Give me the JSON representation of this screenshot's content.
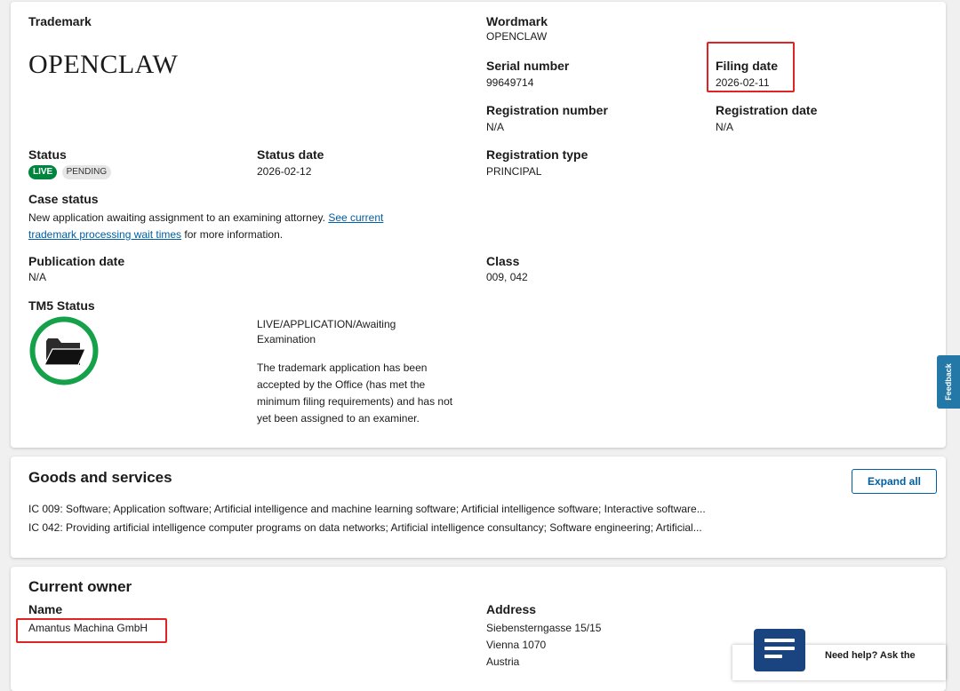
{
  "trademark": {
    "label": "Trademark",
    "wordmark_display": "OPENCLAW",
    "wordmark_label": "Wordmark",
    "wordmark_value": "OPENCLAW",
    "serial_label": "Serial number",
    "serial_value": "99649714",
    "filing_date_label": "Filing date",
    "filing_date_value": "2026-02-11",
    "reg_number_label": "Registration number",
    "reg_number_value": "N/A",
    "reg_date_label": "Registration date",
    "reg_date_value": "N/A",
    "status_label": "Status",
    "status_badges": [
      "LIVE",
      "PENDING"
    ],
    "status_date_label": "Status date",
    "status_date_value": "2026-02-12",
    "reg_type_label": "Registration type",
    "reg_type_value": "PRINCIPAL",
    "case_status_label": "Case status",
    "case_status_text": "New application awaiting assignment to an examining attorney.",
    "case_status_link": "See current trademark processing wait times",
    "case_status_suffix": "for more information.",
    "publication_label": "Publication date",
    "publication_value": "N/A",
    "class_label": "Class",
    "class_value": "009, 042",
    "tm5_label": "TM5 Status",
    "tm5_icon": "folder-icon",
    "tm5_status": "LIVE/APPLICATION/Awaiting Examination",
    "tm5_description": "The trademark application has been accepted by the Office (has met the minimum filing requirements) and has not yet been assigned to an examiner."
  },
  "goods": {
    "title": "Goods and services",
    "expand_label": "Expand all",
    "lines": [
      "IC 009: Software; Application software; Artificial intelligence and machine learning software; Artificial intelligence software; Interactive software...",
      "IC 042: Providing artificial intelligence computer programs on data networks; Artificial intelligence consultancy; Software engineering; Artificial..."
    ]
  },
  "owner": {
    "title": "Current owner",
    "name_label": "Name",
    "name_value": "Amantus Machina GmbH",
    "address_label": "Address",
    "address_lines": [
      "Siebensterngasse 15/15",
      "Vienna 1070",
      "Austria"
    ]
  },
  "feedback": {
    "label": "Feedback"
  },
  "assistant": {
    "help_text": "Need help? Ask the"
  },
  "colors": {
    "live": "#00853e",
    "link": "#005ea2",
    "highlight": "#e02424",
    "tm5_ring": "#14a14a"
  }
}
